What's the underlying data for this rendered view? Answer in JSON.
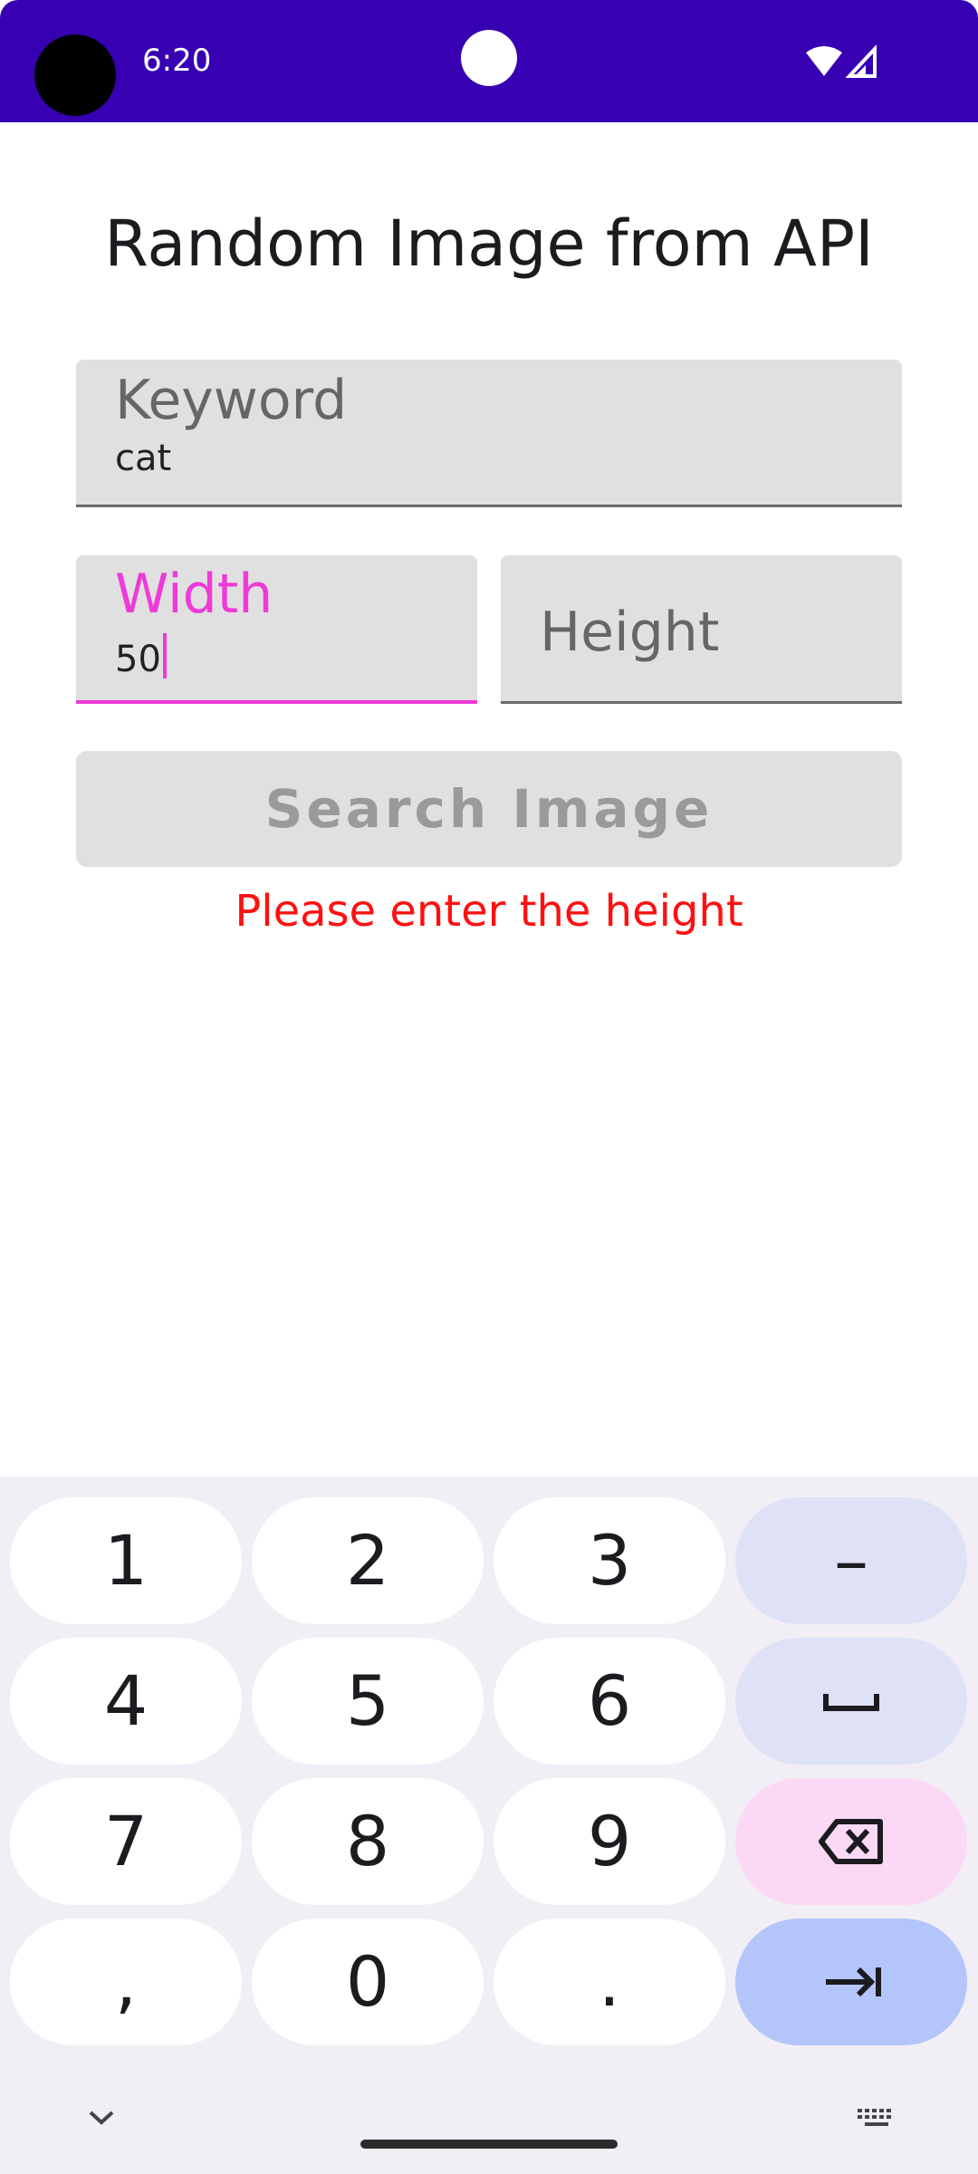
{
  "status_bar": {
    "time": "6:20",
    "background_color": "#3700b3",
    "icons": [
      "wifi-icon",
      "cell-signal-icon"
    ]
  },
  "app": {
    "title": "Random Image from API"
  },
  "form": {
    "keyword": {
      "label": "Keyword",
      "value": "cat"
    },
    "width": {
      "label": "Width",
      "value": "50",
      "focused": true
    },
    "height": {
      "label": "Height",
      "value": ""
    },
    "search_button": "Search Image",
    "error_message": "Please enter the height"
  },
  "colors": {
    "accent": "#ee3ad7",
    "error": "#ff1010"
  },
  "keyboard": {
    "rows": [
      [
        "1",
        "2",
        "3",
        "–"
      ],
      [
        "4",
        "5",
        "6",
        "␣"
      ],
      [
        "7",
        "8",
        "9",
        "⌫"
      ],
      [
        ",",
        "0",
        ".",
        "⇥"
      ]
    ],
    "bottom_icons": [
      "chevron-down-icon",
      "keyboard-icon"
    ]
  }
}
